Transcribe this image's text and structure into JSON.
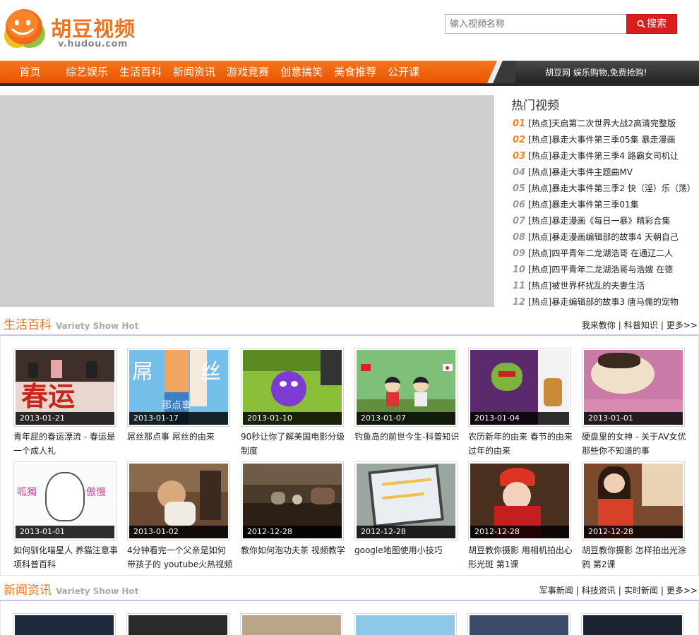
{
  "header": {
    "logo_title": "胡豆视频",
    "logo_sub": "v.hudou.com",
    "search_placeholder": "输入视频名称",
    "search_button": "搜索"
  },
  "nav": {
    "items": [
      "首页",
      "综艺娱乐",
      "生活百科",
      "新闻资讯",
      "游戏竞赛",
      "创意搞笑",
      "美食推荐",
      "公开课"
    ],
    "slogan": "胡豆网 娱乐购物,免费抢购!"
  },
  "hot": {
    "title": "热门视频",
    "items": [
      {
        "num": "01",
        "text": "[热点]天启第二次世界大战2高清完整版"
      },
      {
        "num": "02",
        "text": "[热点]暴走大事件第三季05集 暴走漫画"
      },
      {
        "num": "03",
        "text": "[热点]暴走大事件第三季4 路霸女司机让"
      },
      {
        "num": "04",
        "text": "[热点]暴走大事件主题曲MV"
      },
      {
        "num": "05",
        "text": "[热点]暴走大事件第三季2 快（淫）乐（荡）"
      },
      {
        "num": "06",
        "text": "[热点]暴走大事件第三季01集"
      },
      {
        "num": "07",
        "text": "[热点]暴走漫画《每日一暴》精彩合集"
      },
      {
        "num": "08",
        "text": "[热点]暴走漫画编辑部的故事4 天朝自己"
      },
      {
        "num": "09",
        "text": "[热点]四平青年二龙湖浩哥 在通辽二人"
      },
      {
        "num": "10",
        "text": "[热点]四平青年二龙湖浩哥与浩嫂 在德"
      },
      {
        "num": "11",
        "text": "[热点]被世界杯扰乱的夫妻生活"
      },
      {
        "num": "12",
        "text": "[热点]暴走编辑部的故事3 唐马儒的宠物"
      }
    ]
  },
  "life": {
    "title": "生活百科",
    "sub": "Variety Show Hot",
    "links": [
      "我来教你",
      "科普知识",
      "更多>>"
    ],
    "cards": [
      {
        "date": "2013-01-21",
        "title": "青年屁的春运漂流 - 春运是一个成人礼"
      },
      {
        "date": "2013-01-17",
        "title": "屌丝那点事 屌丝的由来"
      },
      {
        "date": "2013-01-10",
        "title": "90秒让你了解美国电影分级制度"
      },
      {
        "date": "2013-01-07",
        "title": "钓鱼岛的前世今生-科普知识"
      },
      {
        "date": "2013-01-04",
        "title": "农历新年的由来 春节的由来 过年的由来"
      },
      {
        "date": "2013-01-01",
        "title": "硬盘里的女神 - 关于AV女优 那些你不知道的事"
      },
      {
        "date": "2013-01-01",
        "title": "如何驯化喵星人 养猫注意事项科普百科"
      },
      {
        "date": "2013-01-02",
        "title": "4分钟看完一个父亲是如何带孩子的 youtube火热视频"
      },
      {
        "date": "2012-12-28",
        "title": "教你如何泡功夫茶 视频教学"
      },
      {
        "date": "2012-12-28",
        "title": "google地图使用小技巧"
      },
      {
        "date": "2012-12-28",
        "title": "胡豆教你摄影 用相机拍出心形光斑 第1课"
      },
      {
        "date": "2012-12-28",
        "title": "胡豆教你摄影 怎样拍出光涂鸦 第2课"
      }
    ],
    "thumb_text": {
      "chunyun": "春运",
      "ds1": "屌",
      "ds2": "丝",
      "ds3": "那点事",
      "m1": "呱獨",
      "m2": "傲慢"
    }
  },
  "news": {
    "title": "新闻资讯",
    "sub": "Variety Show Hot",
    "links": [
      "军事新闻",
      "科技资讯",
      "实时新闻",
      "更多>>"
    ]
  }
}
